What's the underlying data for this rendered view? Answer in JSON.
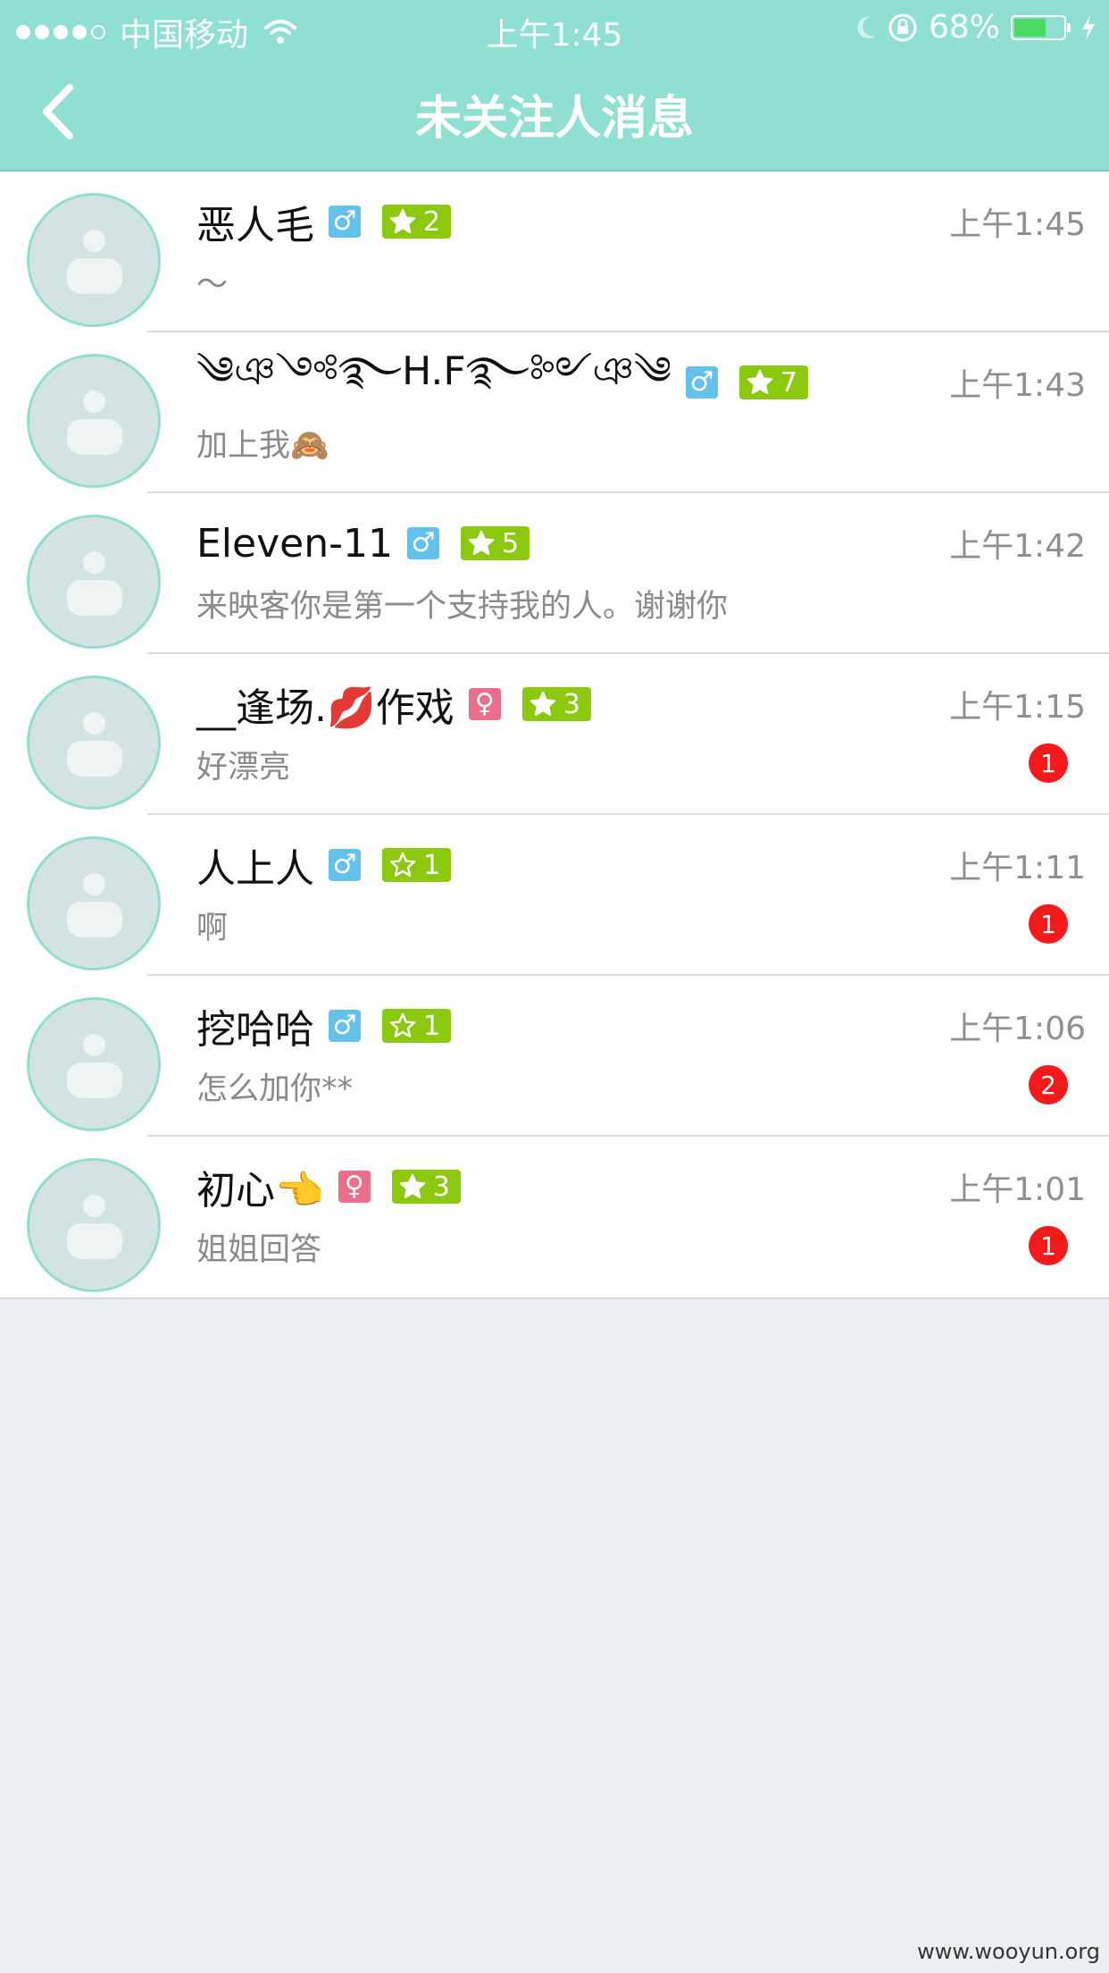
{
  "status_bar": {
    "carrier": "中国移动",
    "time": "上午1:45",
    "battery_percent": "68%",
    "battery_level": 0.68,
    "signal_bars": 4,
    "signal_total": 5
  },
  "nav": {
    "title": "未关注人消息",
    "back_icon": "chevron-left-icon"
  },
  "colors": {
    "header": "#8FE0D2",
    "male": "#63C1EB",
    "female": "#EB6E8C",
    "level": "#8CC90E",
    "unread": "#F21A1A"
  },
  "messages": [
    {
      "name": "恶人毛",
      "gender": "♂",
      "gender_type": "male",
      "level": "2",
      "star": "filled",
      "preview": "～",
      "time": "上午1:45",
      "unread": ""
    },
    {
      "name": "༄ঞ༺࿐H.F࿐༻ঞ༄",
      "gender": "♂",
      "gender_type": "male",
      "level": "7",
      "star": "filled",
      "preview": "加上我🙈",
      "time": "上午1:43",
      "unread": ""
    },
    {
      "name": "Eleven-11",
      "gender": "♂",
      "gender_type": "male",
      "level": "5",
      "star": "filled",
      "preview": "来映客你是第一个支持我的人。谢谢你",
      "time": "上午1:42",
      "unread": ""
    },
    {
      "name": "__逢场.💋作戏",
      "gender": "♀",
      "gender_type": "female",
      "level": "3",
      "star": "filled",
      "preview": "好漂亮",
      "time": "上午1:15",
      "unread": "1"
    },
    {
      "name": "人上人",
      "gender": "♂",
      "gender_type": "male",
      "level": "1",
      "star": "outline",
      "preview": "啊",
      "time": "上午1:11",
      "unread": "1"
    },
    {
      "name": "挖哈哈",
      "gender": "♂",
      "gender_type": "male",
      "level": "1",
      "star": "outline",
      "preview": "怎么加你**",
      "time": "上午1:06",
      "unread": "2"
    },
    {
      "name": "初心👈",
      "gender": "♀",
      "gender_type": "female",
      "level": "3",
      "star": "filled",
      "preview": "姐姐回答",
      "time": "上午1:01",
      "unread": "1"
    }
  ],
  "watermark": "www.wooyun.org"
}
